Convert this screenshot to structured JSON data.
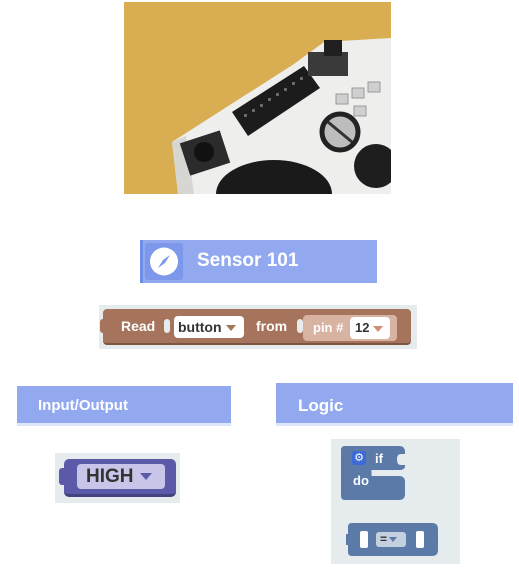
{
  "photo": {
    "description_label": ""
  },
  "sensor_category": {
    "title": "Sensor 101",
    "icon": "compass-icon"
  },
  "read_block": {
    "read_label": "Read",
    "button_dropdown": "button",
    "from_label": "from",
    "pin_label": "pin #",
    "pin_value": "12",
    "color": "#a6735c"
  },
  "io_category": {
    "title": "Input/Output"
  },
  "high_block": {
    "value": "HIGH",
    "color": "#5b5aa8"
  },
  "logic_category": {
    "title": "Logic"
  },
  "if_block": {
    "if_label": "if",
    "do_label": "do",
    "settings_icon": "gear-icon",
    "color": "#5b7aa8"
  },
  "compare_block": {
    "operator": "="
  },
  "colors": {
    "category_header": "#92a9f0",
    "panel": "#e6ebee"
  }
}
